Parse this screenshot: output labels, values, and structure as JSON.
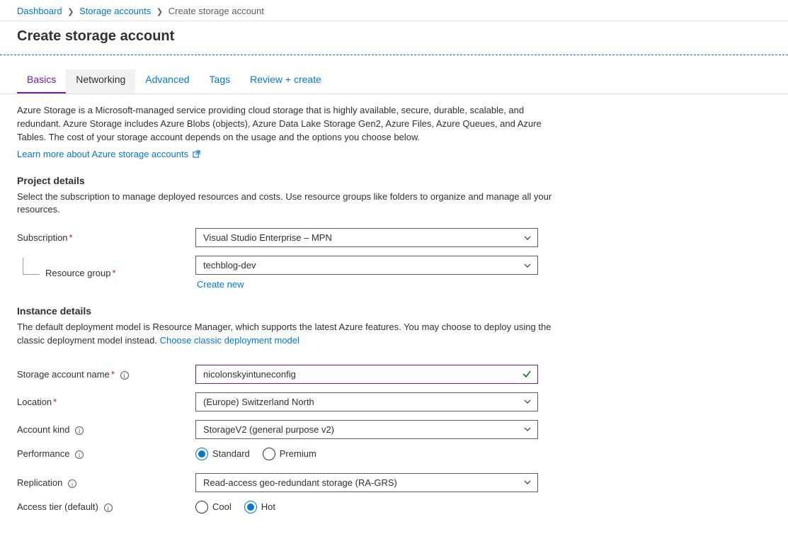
{
  "breadcrumb": {
    "items": [
      {
        "label": "Dashboard",
        "link": true
      },
      {
        "label": "Storage accounts",
        "link": true
      },
      {
        "label": "Create storage account",
        "link": false
      }
    ]
  },
  "title": "Create storage account",
  "tabs": [
    {
      "label": "Basics",
      "state": "selected"
    },
    {
      "label": "Networking",
      "state": "hover"
    },
    {
      "label": "Advanced",
      "state": "default"
    },
    {
      "label": "Tags",
      "state": "default"
    },
    {
      "label": "Review + create",
      "state": "default"
    }
  ],
  "intro": {
    "text": "Azure Storage is a Microsoft-managed service providing cloud storage that is highly available, secure, durable, scalable, and redundant. Azure Storage includes Azure Blobs (objects), Azure Data Lake Storage Gen2, Azure Files, Azure Queues, and Azure Tables. The cost of your storage account depends on the usage and the options you choose below.",
    "learn_more": "Learn more about Azure storage accounts"
  },
  "project_details": {
    "heading": "Project details",
    "desc": "Select the subscription to manage deployed resources and costs. Use resource groups like folders to organize and manage all your resources.",
    "subscription_label": "Subscription",
    "subscription_value": "Visual Studio Enterprise – MPN",
    "resource_group_label": "Resource group",
    "resource_group_value": "techblog-dev",
    "create_new": "Create new"
  },
  "instance_details": {
    "heading": "Instance details",
    "desc_prefix": "The default deployment model is Resource Manager, which supports the latest Azure features. You may choose to deploy using the classic deployment model instead.  ",
    "choose_classic": "Choose classic deployment model",
    "name_label": "Storage account name",
    "name_value": "nicolonskyintuneconfig",
    "location_label": "Location",
    "location_value": "(Europe) Switzerland North",
    "account_kind_label": "Account kind",
    "account_kind_value": "StorageV2 (general purpose v2)",
    "performance_label": "Performance",
    "performance_options": [
      {
        "label": "Standard",
        "selected": true
      },
      {
        "label": "Premium",
        "selected": false
      }
    ],
    "replication_label": "Replication",
    "replication_value": "Read-access geo-redundant storage (RA-GRS)",
    "access_tier_label": "Access tier (default)",
    "access_tier_options": [
      {
        "label": "Cool",
        "selected": false
      },
      {
        "label": "Hot",
        "selected": true
      }
    ]
  }
}
